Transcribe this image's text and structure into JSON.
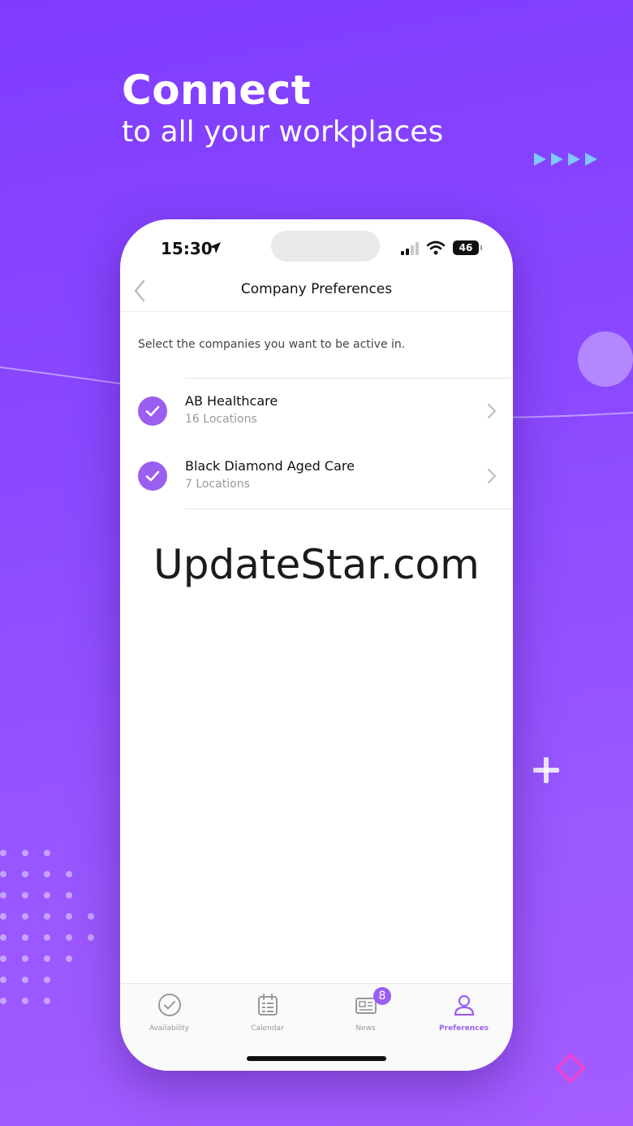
{
  "promo": {
    "headline": "Connect",
    "subheadline": "to all your workplaces"
  },
  "status_bar": {
    "time": "15:30",
    "battery": "46"
  },
  "nav": {
    "title": "Company Preferences"
  },
  "instruction": "Select the companies you want to be active in.",
  "companies": [
    {
      "name": "AB Healthcare",
      "locations": "16 Locations",
      "checked": true
    },
    {
      "name": "Black Diamond Aged Care",
      "locations": "7 Locations",
      "checked": true
    }
  ],
  "watermark": "UpdateStar.com",
  "tabs": [
    {
      "label": "Availability",
      "icon": "check-circle-icon"
    },
    {
      "label": "Calendar",
      "icon": "calendar-icon"
    },
    {
      "label": "News",
      "icon": "newspaper-icon",
      "badge": "8"
    },
    {
      "label": "Preferences",
      "icon": "user-icon",
      "active": true
    }
  ],
  "colors": {
    "accent": "#9a5ff0",
    "background_start": "#7f3cff",
    "background_end": "#a45cff",
    "decor_arrows": "#7ec9ff",
    "decor_diamond": "#ff3ec8"
  }
}
